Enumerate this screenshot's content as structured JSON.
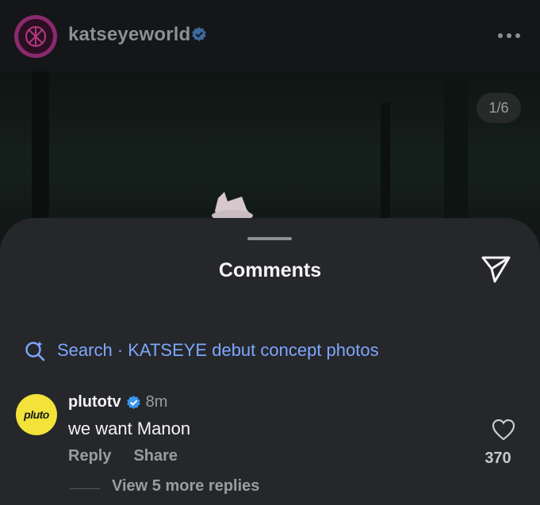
{
  "post": {
    "username": "katseyeworld",
    "verified_icon": "verified-badge-icon",
    "more_icon": "more-horizontal-icon",
    "photo_counter": "1/6"
  },
  "comments_sheet": {
    "title": "Comments",
    "send_icon": "send-paper-plane-icon",
    "search_label": "Search · KATSEYE debut concept photos",
    "search_icon": "search-sparkle-icon"
  },
  "comment": {
    "avatar_text": "pluto",
    "username": "plutotv",
    "time": "8m",
    "text": "we want Manon",
    "reply_label": "Reply",
    "share_label": "Share",
    "likes": "370",
    "heart_icon": "heart-outline-icon",
    "view_replies": "View 5 more replies"
  },
  "colors": {
    "background": "#141618",
    "sheet": "#25272a",
    "link_blue": "#7ea6ff",
    "verified_blue": "#3897f0",
    "avatar_ring": "#8a2a6e",
    "pluto_yellow": "#f2e23a"
  }
}
